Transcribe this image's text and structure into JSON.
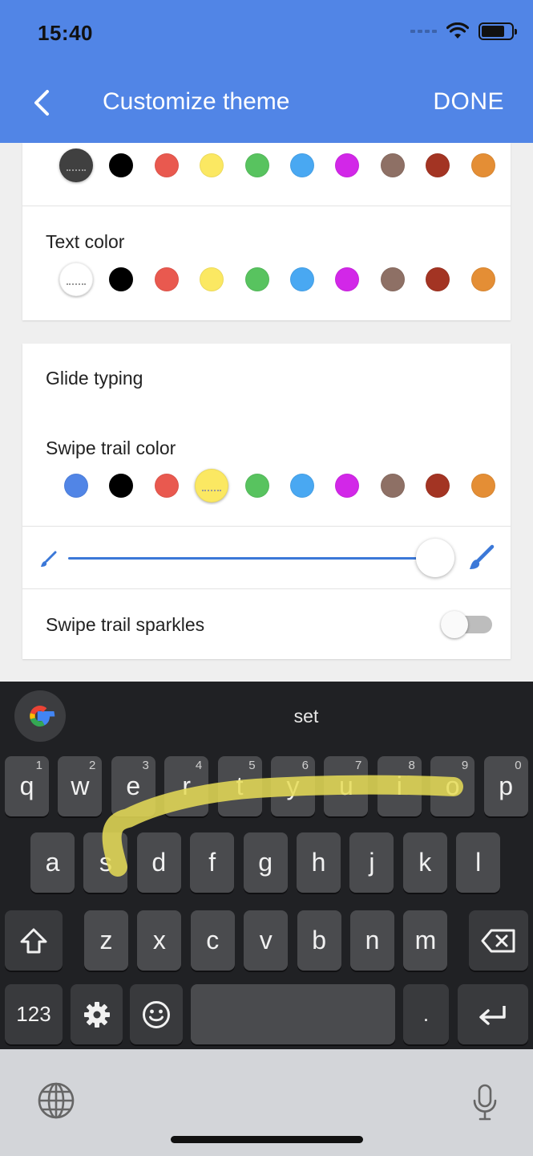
{
  "status_bar": {
    "time": "15:40"
  },
  "header": {
    "title": "Customize theme",
    "done_label": "DONE"
  },
  "palette": [
    "#404040",
    "#000000",
    "#e9594f",
    "#fbe862",
    "#58c35f",
    "#49a8f2",
    "#d227e8",
    "#8e7065",
    "#a33423",
    "#e48e35"
  ],
  "key_color": {
    "selected_color": "#404040"
  },
  "text_color": {
    "label": "Text color",
    "selected_color": "#ffffff"
  },
  "glide_typing": {
    "heading": "Glide typing",
    "swipe_trail_color_label": "Swipe trail color",
    "swipe_trail_palette_first": "#5185e6",
    "selected_color": "#fbe862",
    "trail_width_level": 0.9,
    "sparkles_label": "Swipe trail sparkles",
    "sparkles_enabled": false
  },
  "keyboard": {
    "suggestion": "set",
    "row1": [
      {
        "k": "q",
        "n": "1"
      },
      {
        "k": "w",
        "n": "2"
      },
      {
        "k": "e",
        "n": "3"
      },
      {
        "k": "r",
        "n": "4"
      },
      {
        "k": "t",
        "n": "5"
      },
      {
        "k": "y",
        "n": "6"
      },
      {
        "k": "u",
        "n": "7"
      },
      {
        "k": "i",
        "n": "8"
      },
      {
        "k": "o",
        "n": "9"
      },
      {
        "k": "p",
        "n": "0"
      }
    ],
    "row2": [
      "a",
      "s",
      "d",
      "f",
      "g",
      "h",
      "j",
      "k",
      "l"
    ],
    "row3": [
      "z",
      "x",
      "c",
      "v",
      "b",
      "n",
      "m"
    ],
    "numbers_label": "123",
    "period_label": ".",
    "trail_color": "#e8dd57"
  },
  "icons": {
    "back": "chevron-left-icon",
    "google": "google-g-icon",
    "shift": "shift-icon",
    "backspace": "backspace-icon",
    "settings": "gear-icon",
    "emoji": "emoji-icon",
    "enter": "return-icon",
    "globe": "globe-icon",
    "mic": "microphone-icon",
    "brush": "brush-icon"
  }
}
